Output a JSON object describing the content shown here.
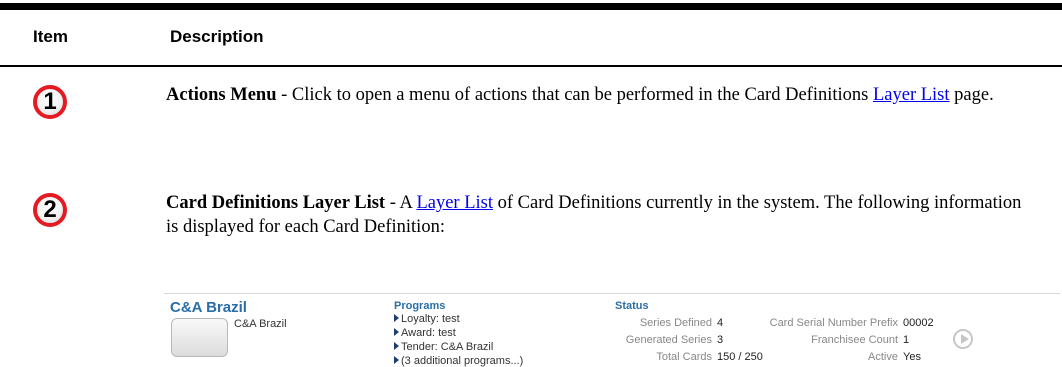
{
  "table": {
    "header_item": "Item",
    "header_description": "Description"
  },
  "rows": [
    {
      "number": "1",
      "title": "Actions Menu",
      "text_before": " - Click to open a menu of actions that can be performed in the Card Definitions ",
      "link": "Layer List",
      "text_after": " page."
    },
    {
      "number": "2",
      "title": "Card Definitions Layer List",
      "text_before": " - A ",
      "link": "Layer List",
      "text_after": " of Card Definitions currently in the system. The following information is displayed for each Card Definition:"
    }
  ],
  "card": {
    "name": "C&A Brazil",
    "subtitle": "C&A Brazil",
    "programs_title": "Programs",
    "programs": [
      "Loyalty: test",
      "Award: test",
      "Tender: C&A Brazil",
      "(3 additional programs...)"
    ],
    "status_title": "Status",
    "stats_left": [
      {
        "label": "Series Defined",
        "value": "4"
      },
      {
        "label": "Generated Series",
        "value": "3"
      },
      {
        "label": "Total Cards",
        "value": "150 / 250"
      }
    ],
    "stats_right": [
      {
        "label": "Card Serial Number Prefix",
        "value": "00002"
      },
      {
        "label": "Franchisee Count",
        "value": "1"
      },
      {
        "label": "Active",
        "value": "Yes"
      }
    ],
    "colors": {
      "title": "#2a6ea8",
      "callout_ring": "#e31b23"
    },
    "icons": {
      "callout": "numbered-circle-icon",
      "play": "play-circle-icon",
      "thumb": "card-thumbnail-icon"
    }
  }
}
